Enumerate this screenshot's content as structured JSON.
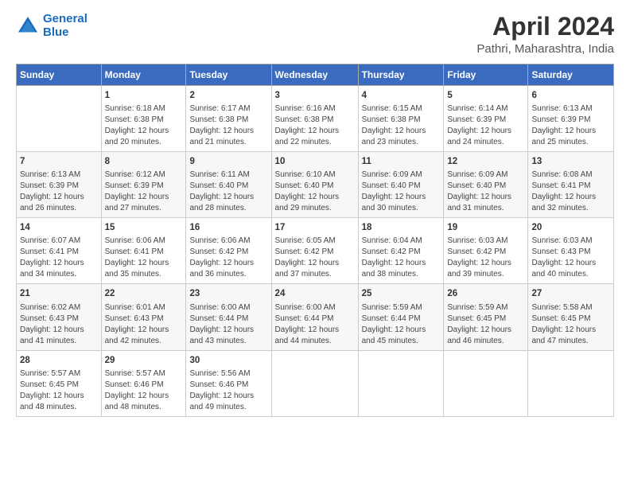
{
  "logo": {
    "line1": "General",
    "line2": "Blue"
  },
  "title": "April 2024",
  "subtitle": "Pathri, Maharashtra, India",
  "days": [
    "Sunday",
    "Monday",
    "Tuesday",
    "Wednesday",
    "Thursday",
    "Friday",
    "Saturday"
  ],
  "weeks": [
    [
      {
        "date": "",
        "text": ""
      },
      {
        "date": "1",
        "text": "Sunrise: 6:18 AM\nSunset: 6:38 PM\nDaylight: 12 hours\nand 20 minutes."
      },
      {
        "date": "2",
        "text": "Sunrise: 6:17 AM\nSunset: 6:38 PM\nDaylight: 12 hours\nand 21 minutes."
      },
      {
        "date": "3",
        "text": "Sunrise: 6:16 AM\nSunset: 6:38 PM\nDaylight: 12 hours\nand 22 minutes."
      },
      {
        "date": "4",
        "text": "Sunrise: 6:15 AM\nSunset: 6:38 PM\nDaylight: 12 hours\nand 23 minutes."
      },
      {
        "date": "5",
        "text": "Sunrise: 6:14 AM\nSunset: 6:39 PM\nDaylight: 12 hours\nand 24 minutes."
      },
      {
        "date": "6",
        "text": "Sunrise: 6:13 AM\nSunset: 6:39 PM\nDaylight: 12 hours\nand 25 minutes."
      }
    ],
    [
      {
        "date": "7",
        "text": "Sunrise: 6:13 AM\nSunset: 6:39 PM\nDaylight: 12 hours\nand 26 minutes."
      },
      {
        "date": "8",
        "text": "Sunrise: 6:12 AM\nSunset: 6:39 PM\nDaylight: 12 hours\nand 27 minutes."
      },
      {
        "date": "9",
        "text": "Sunrise: 6:11 AM\nSunset: 6:40 PM\nDaylight: 12 hours\nand 28 minutes."
      },
      {
        "date": "10",
        "text": "Sunrise: 6:10 AM\nSunset: 6:40 PM\nDaylight: 12 hours\nand 29 minutes."
      },
      {
        "date": "11",
        "text": "Sunrise: 6:09 AM\nSunset: 6:40 PM\nDaylight: 12 hours\nand 30 minutes."
      },
      {
        "date": "12",
        "text": "Sunrise: 6:09 AM\nSunset: 6:40 PM\nDaylight: 12 hours\nand 31 minutes."
      },
      {
        "date": "13",
        "text": "Sunrise: 6:08 AM\nSunset: 6:41 PM\nDaylight: 12 hours\nand 32 minutes."
      }
    ],
    [
      {
        "date": "14",
        "text": "Sunrise: 6:07 AM\nSunset: 6:41 PM\nDaylight: 12 hours\nand 34 minutes."
      },
      {
        "date": "15",
        "text": "Sunrise: 6:06 AM\nSunset: 6:41 PM\nDaylight: 12 hours\nand 35 minutes."
      },
      {
        "date": "16",
        "text": "Sunrise: 6:06 AM\nSunset: 6:42 PM\nDaylight: 12 hours\nand 36 minutes."
      },
      {
        "date": "17",
        "text": "Sunrise: 6:05 AM\nSunset: 6:42 PM\nDaylight: 12 hours\nand 37 minutes."
      },
      {
        "date": "18",
        "text": "Sunrise: 6:04 AM\nSunset: 6:42 PM\nDaylight: 12 hours\nand 38 minutes."
      },
      {
        "date": "19",
        "text": "Sunrise: 6:03 AM\nSunset: 6:42 PM\nDaylight: 12 hours\nand 39 minutes."
      },
      {
        "date": "20",
        "text": "Sunrise: 6:03 AM\nSunset: 6:43 PM\nDaylight: 12 hours\nand 40 minutes."
      }
    ],
    [
      {
        "date": "21",
        "text": "Sunrise: 6:02 AM\nSunset: 6:43 PM\nDaylight: 12 hours\nand 41 minutes."
      },
      {
        "date": "22",
        "text": "Sunrise: 6:01 AM\nSunset: 6:43 PM\nDaylight: 12 hours\nand 42 minutes."
      },
      {
        "date": "23",
        "text": "Sunrise: 6:00 AM\nSunset: 6:44 PM\nDaylight: 12 hours\nand 43 minutes."
      },
      {
        "date": "24",
        "text": "Sunrise: 6:00 AM\nSunset: 6:44 PM\nDaylight: 12 hours\nand 44 minutes."
      },
      {
        "date": "25",
        "text": "Sunrise: 5:59 AM\nSunset: 6:44 PM\nDaylight: 12 hours\nand 45 minutes."
      },
      {
        "date": "26",
        "text": "Sunrise: 5:59 AM\nSunset: 6:45 PM\nDaylight: 12 hours\nand 46 minutes."
      },
      {
        "date": "27",
        "text": "Sunrise: 5:58 AM\nSunset: 6:45 PM\nDaylight: 12 hours\nand 47 minutes."
      }
    ],
    [
      {
        "date": "28",
        "text": "Sunrise: 5:57 AM\nSunset: 6:45 PM\nDaylight: 12 hours\nand 48 minutes."
      },
      {
        "date": "29",
        "text": "Sunrise: 5:57 AM\nSunset: 6:46 PM\nDaylight: 12 hours\nand 48 minutes."
      },
      {
        "date": "30",
        "text": "Sunrise: 5:56 AM\nSunset: 6:46 PM\nDaylight: 12 hours\nand 49 minutes."
      },
      {
        "date": "",
        "text": ""
      },
      {
        "date": "",
        "text": ""
      },
      {
        "date": "",
        "text": ""
      },
      {
        "date": "",
        "text": ""
      }
    ]
  ]
}
